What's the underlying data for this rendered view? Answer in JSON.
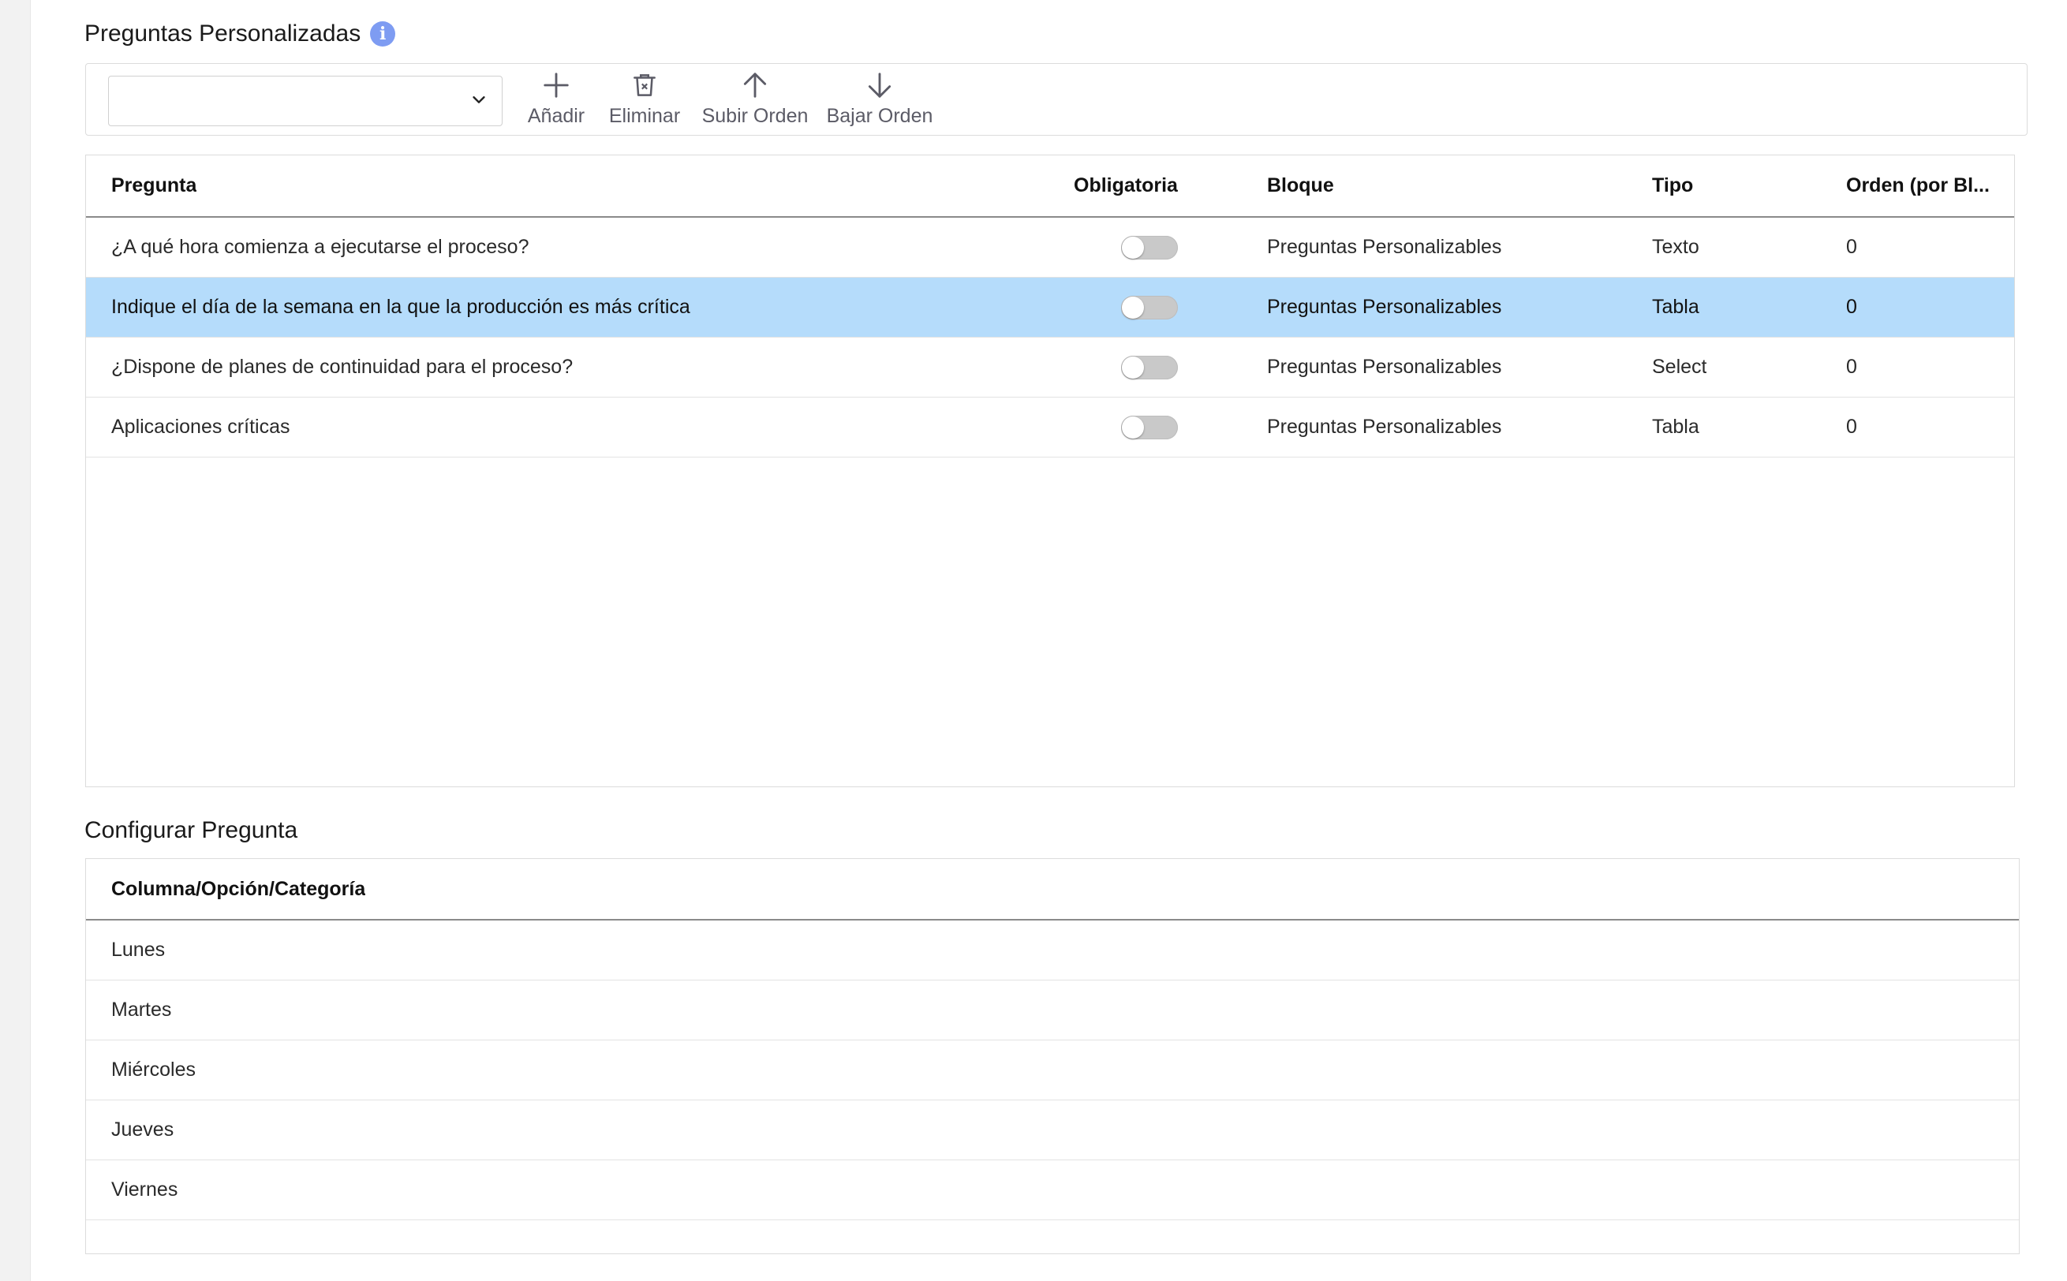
{
  "questions_section": {
    "title": "Preguntas Personalizadas",
    "info_icon": "info-icon"
  },
  "toolbar": {
    "select_value": "",
    "add_label": "Añadir",
    "delete_label": "Eliminar",
    "move_up_label": "Subir Orden",
    "move_down_label": "Bajar Orden"
  },
  "questions_table": {
    "columns": [
      "Pregunta",
      "Obligatoria",
      "Bloque",
      "Tipo",
      "Orden (por Bl..."
    ],
    "rows": [
      {
        "pregunta": "¿A qué hora comienza a ejecutarse el proceso?",
        "obligatoria": false,
        "bloque": "Preguntas Personalizables",
        "tipo": "Texto",
        "orden": "0",
        "selected": false
      },
      {
        "pregunta": "Indique el día de la semana en la que la producción es más crítica",
        "obligatoria": false,
        "bloque": "Preguntas Personalizables",
        "tipo": "Tabla",
        "orden": "0",
        "selected": true
      },
      {
        "pregunta": "¿Dispone de planes de continuidad para el proceso?",
        "obligatoria": false,
        "bloque": "Preguntas Personalizables",
        "tipo": "Select",
        "orden": "0",
        "selected": false
      },
      {
        "pregunta": "Aplicaciones críticas",
        "obligatoria": false,
        "bloque": "Preguntas Personalizables",
        "tipo": "Tabla",
        "orden": "0",
        "selected": false
      }
    ]
  },
  "configure_section": {
    "title": "Configurar Pregunta",
    "column_header": "Columna/Opción/Categoría",
    "options": [
      "Lunes",
      "Martes",
      "Miércoles",
      "Jueves",
      "Viernes"
    ]
  },
  "colors": {
    "selected_row": "#b5dcfb",
    "info_icon": "#7e9cf2",
    "toggle_off": "#c9c9c9"
  }
}
